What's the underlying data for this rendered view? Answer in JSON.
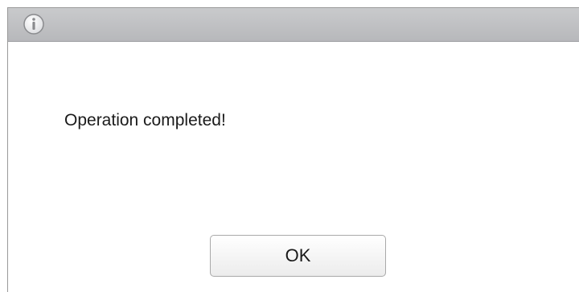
{
  "dialog": {
    "icon": "info-icon",
    "message": "Operation completed!",
    "ok_label": "OK"
  },
  "colors": {
    "titlebar": "#bfc0c3",
    "icon_fill": "#ffffff",
    "icon_stroke": "#8a8b8e"
  }
}
